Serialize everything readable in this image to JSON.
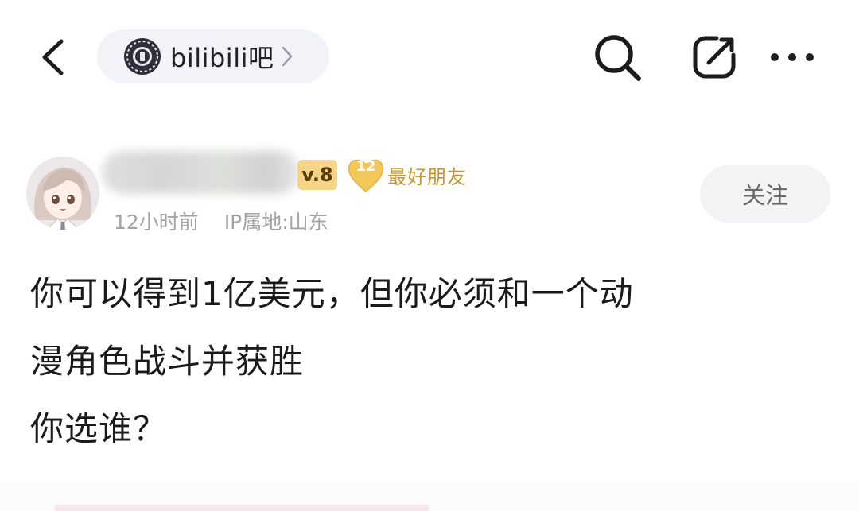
{
  "topbar": {
    "forum_name": "bilibili吧",
    "back_icon": "chevron-left-icon",
    "forum_logo_icon": "bilibili-forum-logo-icon",
    "forum_chevron_icon": "chevron-right-icon",
    "search_icon": "search-icon",
    "share_icon": "share-icon",
    "more_icon": "more-dots-icon"
  },
  "post": {
    "author": {
      "level": "v.8",
      "friend_level": "12",
      "friend_label": "最好朋友",
      "avatar_icon": "anime-avatar"
    },
    "time": "12小时前",
    "ip_location": "IP属地:山东",
    "follow_label": "关注",
    "lines": [
      "你可以得到1亿美元，但你必须和一个动",
      "漫角色战斗并获胜",
      "你选谁？"
    ]
  },
  "colors": {
    "background": "#ffffff",
    "chip_background": "#f1f3f8",
    "level_badge": "#f6d588",
    "friend_gold": "#c69631",
    "meta_gray": "#a3a3a3",
    "follow_bg": "#f3f3f5"
  }
}
